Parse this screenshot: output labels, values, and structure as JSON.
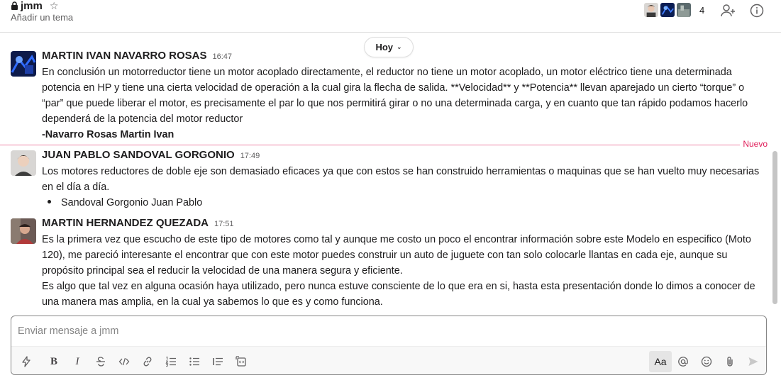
{
  "channel": {
    "name": "jmm",
    "topic_placeholder": "Añadir un tema",
    "member_count": "4"
  },
  "day_divider": {
    "label": "Hoy"
  },
  "new_divider": {
    "label": "Nuevo"
  },
  "messages": [
    {
      "author": "MARTIN IVAN NAVARRO ROSAS",
      "time": "16:47",
      "lines": [
        "En conclusión un motorreductor tiene un motor acoplado directamente, el reductor no tiene un motor acoplado, un motor eléctrico tiene una determinada potencia en HP y tiene una cierta velocidad de operación a la cual gira la flecha de salida. **Velocidad** y **Potencia** llevan aparejado un cierto “torque” o “par” que puede liberar el motor, es precisamente el par lo que nos permitirá girar o no una determinada carga, y en cuanto que tan rápido podamos hacerlo dependerá de la potencia del motor reductor"
      ],
      "signature": "-Navarro Rosas Martin Ivan"
    },
    {
      "author": "JUAN PABLO SANDOVAL GORGONIO",
      "time": "17:49",
      "lines": [
        "Los motores reductores de doble eje son demasiado eficaces ya que con estos se han construido herramientas o maquinas que se han vuelto muy necesarias en el día a día."
      ],
      "bullet": "Sandoval Gorgonio Juan Pablo"
    },
    {
      "author": "MARTIN HERNANDEZ QUEZADA",
      "time": "17:51",
      "lines": [
        "Es la primera vez que escucho de este tipo de motores como tal y aunque me costo un poco el encontrar información sobre este Modelo en especifico (Moto 120), me pareció interesante el encontrar que con este motor puedes construir un auto de juguete con tan solo colocarle llantas en cada eje, aunque su propósito principal sea el reducir la velocidad de una manera segura y eficiente.",
        "Es algo que tal vez en alguna ocasión haya utilizado, pero nunca estuve consciente de lo que era en si, hasta esta presentación donde lo dimos a conocer de una manera mas amplia, en la cual ya sabemos lo que es y como funciona."
      ]
    }
  ],
  "composer": {
    "placeholder": "Enviar mensaje a jmm",
    "value": "",
    "format_toggle_label": "Aa"
  },
  "icons": {
    "header": [
      "lock-icon",
      "star-icon",
      "add-member-icon",
      "info-icon"
    ],
    "toolbar": [
      "lightning-icon",
      "bold-icon",
      "italic-icon",
      "strikethrough-icon",
      "code-icon",
      "link-icon",
      "ordered-list-icon",
      "bulleted-list-icon",
      "blockquote-icon",
      "code-block-icon",
      "mention-icon",
      "emoji-icon",
      "attachment-icon",
      "send-icon"
    ]
  },
  "colors": {
    "new_divider": "#e01e5a",
    "text": "#1d1c1d",
    "muted": "#616061"
  }
}
